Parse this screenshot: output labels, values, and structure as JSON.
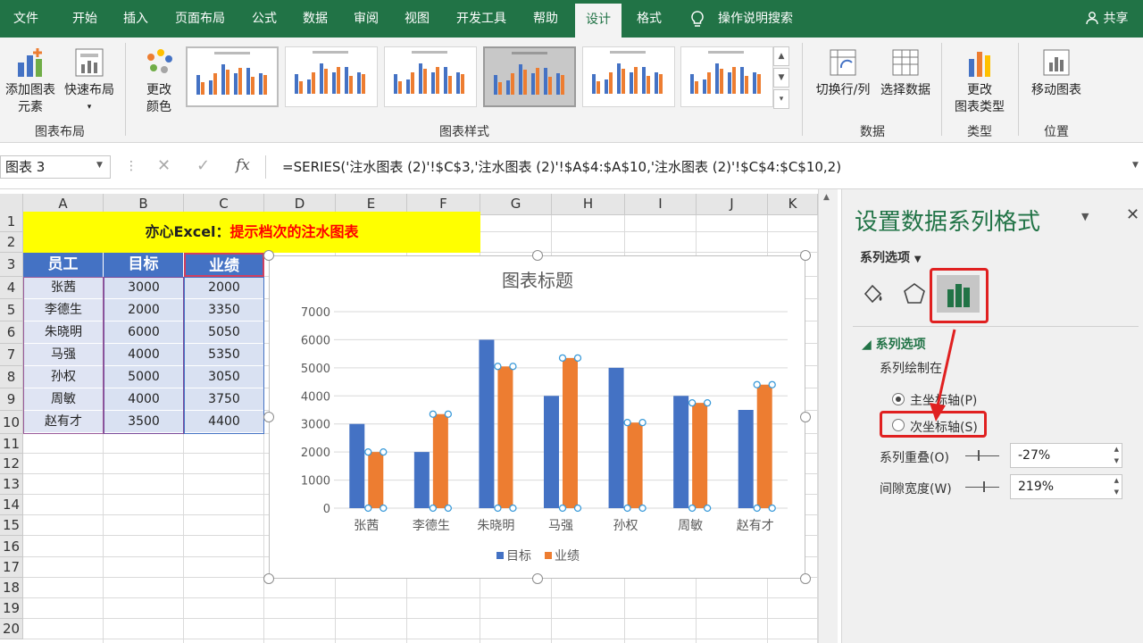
{
  "tabs": [
    "文件",
    "开始",
    "插入",
    "页面布局",
    "公式",
    "数据",
    "审阅",
    "视图",
    "开发工具",
    "帮助",
    "设计",
    "格式"
  ],
  "tab_active": "设计",
  "tell_me": "操作说明搜索",
  "share": "共享",
  "ribbon": {
    "add_element_1": "添加图表",
    "add_element_2": "元素",
    "quick_layout": "快速布局",
    "change_colors_1": "更改",
    "change_colors_2": "颜色",
    "group_layout": "图表布局",
    "group_styles": "图表样式",
    "switch_rowcol": "切换行/列",
    "select_data": "选择数据",
    "group_data": "数据",
    "change_type_1": "更改",
    "change_type_2": "图表类型",
    "group_type": "类型",
    "move_chart": "移动图表",
    "group_location": "位置"
  },
  "formula_bar": {
    "name_box": "图表 3",
    "formula": "=SERIES('注水图表 (2)'!$C$3,'注水图表 (2)'!$A$4:$A$10,'注水图表 (2)'!$C$4:$C$10,2)"
  },
  "sheet": {
    "columns": [
      "A",
      "B",
      "C",
      "D",
      "E",
      "F",
      "G",
      "H",
      "I",
      "J",
      "K"
    ],
    "rows": [
      "1",
      "2",
      "3",
      "4",
      "5",
      "6",
      "7",
      "8",
      "9",
      "10",
      "11",
      "12",
      "13",
      "14",
      "15",
      "16",
      "17",
      "18",
      "19",
      "20"
    ],
    "banner_black": "亦心Excel：",
    "banner_red": "提示档次的注水图表",
    "headers": [
      "员工",
      "目标",
      "业绩"
    ],
    "data": [
      [
        "张茜",
        "3000",
        "2000"
      ],
      [
        "李德生",
        "2000",
        "3350"
      ],
      [
        "朱晓明",
        "6000",
        "5050"
      ],
      [
        "马强",
        "4000",
        "5350"
      ],
      [
        "孙权",
        "5000",
        "3050"
      ],
      [
        "周敏",
        "4000",
        "3750"
      ],
      [
        "赵有才",
        "3500",
        "4400"
      ]
    ]
  },
  "chart_data": {
    "type": "bar",
    "title": "图表标题",
    "categories": [
      "张茜",
      "李德生",
      "朱晓明",
      "马强",
      "孙权",
      "周敏",
      "赵有才"
    ],
    "series": [
      {
        "name": "目标",
        "values": [
          3000,
          2000,
          6000,
          4000,
          5000,
          4000,
          3500
        ],
        "color": "#4472c4"
      },
      {
        "name": "业绩",
        "values": [
          2000,
          3350,
          5050,
          5350,
          3050,
          3750,
          4400
        ],
        "color": "#ed7d31"
      }
    ],
    "ylim": [
      0,
      7000
    ],
    "yticks": [
      "0",
      "1000",
      "2000",
      "3000",
      "4000",
      "5000",
      "6000",
      "7000"
    ],
    "grid": true,
    "legend": "bottom"
  },
  "pane": {
    "title": "设置数据系列格式",
    "series_options_dropdown": "系列选项",
    "section": "系列选项",
    "plot_on": "系列绘制在",
    "primary_axis": "主坐标轴(P)",
    "secondary_axis": "次坐标轴(S)",
    "overlap_label": "系列重叠(O)",
    "overlap_value": "-27%",
    "gap_label": "间隙宽度(W)",
    "gap_value": "219%",
    "primary_selected": true
  },
  "colors": {
    "excel_green": "#217346",
    "accent_red": "#e02020",
    "header_blue": "#4472c4"
  }
}
